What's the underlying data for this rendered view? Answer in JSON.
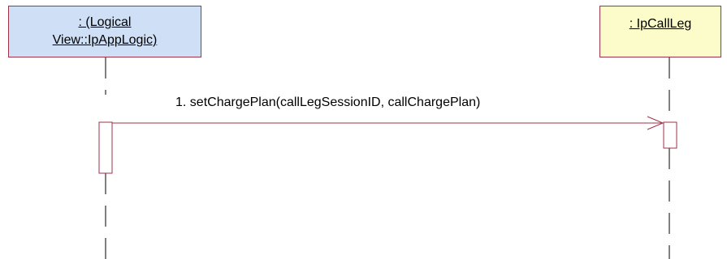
{
  "lifelines": [
    {
      "id": "app-logic",
      "label_line1": ": (Logical",
      "label_line2": "View::IpAppLogic)",
      "color": "#cfe0f6"
    },
    {
      "id": "call-leg",
      "label": ": IpCallLeg",
      "color": "#fcfcca"
    }
  ],
  "messages": [
    {
      "number": "1.",
      "label": "1. setChargePlan(callLegSessionID, callChargePlan)"
    }
  ],
  "colors": {
    "border": "#a0324a",
    "line": "#000000"
  }
}
